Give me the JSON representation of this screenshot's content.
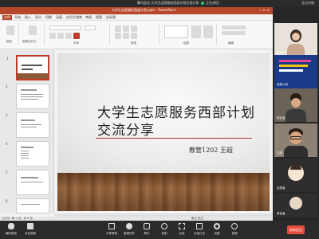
{
  "meeting": {
    "title": "腾讯会议 大学生志愿服务西部计划交流分享",
    "speaker": "正在讲话：",
    "status": "会议详情"
  },
  "ppt": {
    "window_title": "大学生志愿服务西部计划.pptx - PowerPoint",
    "window_controls": "— ☐ ✕",
    "menu": [
      "文件",
      "开始",
      "插入",
      "设计",
      "切换",
      "动画",
      "幻灯片放映",
      "审阅",
      "视图",
      "告诉我"
    ],
    "ribbon_labels": [
      "粘贴",
      "新建幻灯片",
      "字体",
      "段落",
      "绘图",
      "编辑"
    ],
    "thumb_numbers": [
      "1",
      "2",
      "3",
      "4",
      "5",
      "6"
    ],
    "status_left": "幻灯片 第 1 张，共 8 张",
    "status_right": "备注  批注"
  },
  "slide": {
    "title_line1": "大学生志愿服务西部计划",
    "title_line2": "交流分享",
    "author": "教管1202  王超"
  },
  "participants": [
    {
      "name": "主持人"
    },
    {
      "name": "西部计划"
    },
    {
      "name": "参会者"
    },
    {
      "name": "王超"
    },
    {
      "name": "志愿者"
    },
    {
      "name": "参会者"
    }
  ],
  "toolbar": {
    "buttons": [
      "解除静音",
      "开启视频",
      "共享屏幕",
      "管理成员",
      "聊天",
      "录制",
      "应用",
      "分组讨论",
      "设置",
      "表情"
    ],
    "end_label": "结束会议"
  },
  "colors": {
    "ppt_accent": "#b7472a",
    "rule": "#b03030",
    "end": "#e74c3c"
  }
}
